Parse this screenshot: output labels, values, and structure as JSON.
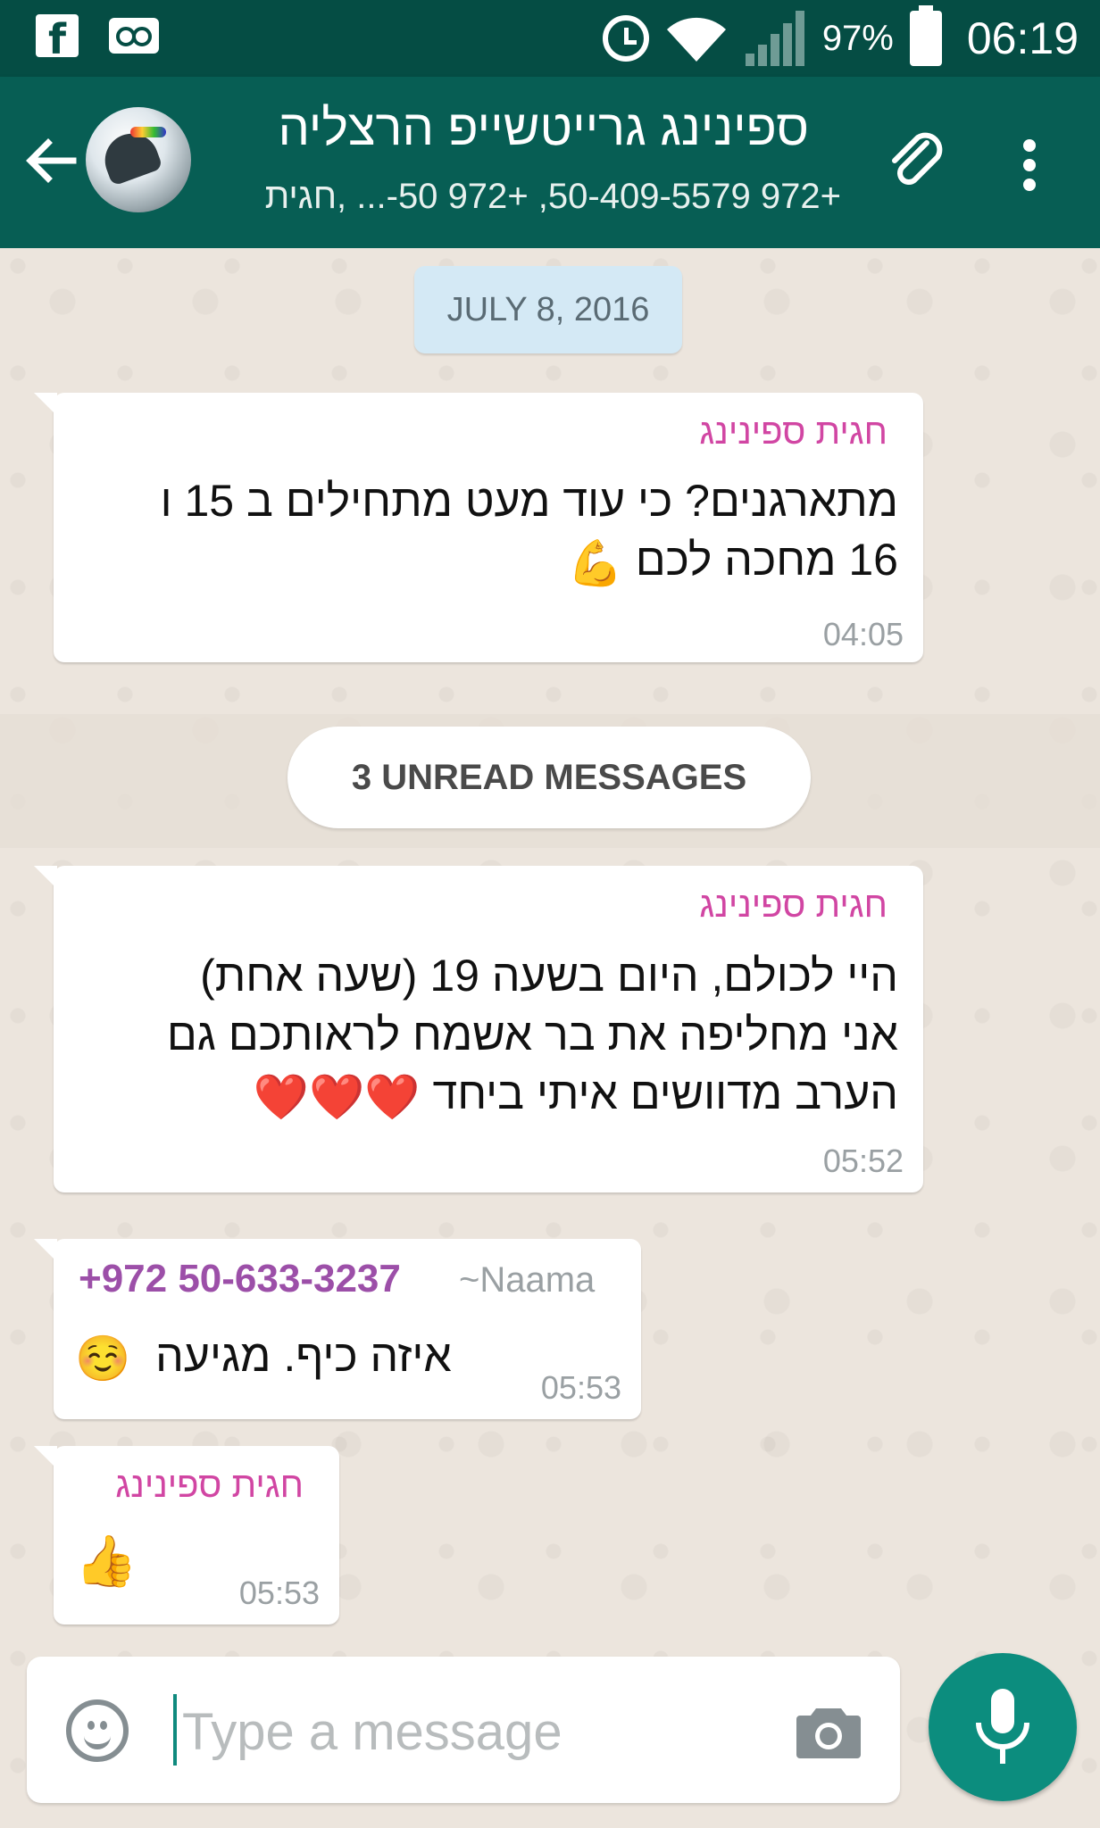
{
  "status_bar": {
    "battery": "97%",
    "time": "06:19"
  },
  "header": {
    "title": "ספינינג  גרייטשייפ הרצליה",
    "subtitle": "+972 50-409-5579, +972 50-... ,חגית"
  },
  "chat": {
    "date_chip": "JULY 8, 2016",
    "unread_label": "3 UNREAD MESSAGES",
    "messages": [
      {
        "sender": "חגית ספינינג",
        "line1": "מתארגנים? כי עוד מעט מתחילים ב 15 ו",
        "line2": "16 מחכה לכם",
        "emoji": "💪",
        "time": "04:05"
      },
      {
        "sender": "חגית ספינינג",
        "line1": "היי לכולם, היום בשעה 19 (שעה אחת)",
        "line2": "אני מחליפה את בר אשמח לראותכם גם",
        "line3": "הערב מדוושים איתי ביחד",
        "emoji": "❤️❤️❤️",
        "time": "05:52"
      },
      {
        "sender_phone": "+972 50-633-3237",
        "sender_name": "~Naama",
        "text": "איזה כיף. מגיעה",
        "emoji": "☺️",
        "time": "05:53"
      },
      {
        "sender": "חגית ספינינג",
        "emoji": "👍",
        "time": "05:53"
      }
    ]
  },
  "composer": {
    "placeholder": "Type a message"
  },
  "colors": {
    "status_bar": "#054d44",
    "app_bar": "#075e54",
    "sender_name": "#d146a3",
    "naama_phone": "#9c4fa8",
    "mic_button": "#0c8d7e"
  },
  "icons": [
    "facebook-icon",
    "voicemail-icon",
    "alarm-icon",
    "wifi-icon",
    "signal-icon",
    "battery-icon",
    "back-arrow-icon",
    "paperclip-icon",
    "more-vert-icon",
    "emoji-icon",
    "camera-icon",
    "mic-icon"
  ]
}
